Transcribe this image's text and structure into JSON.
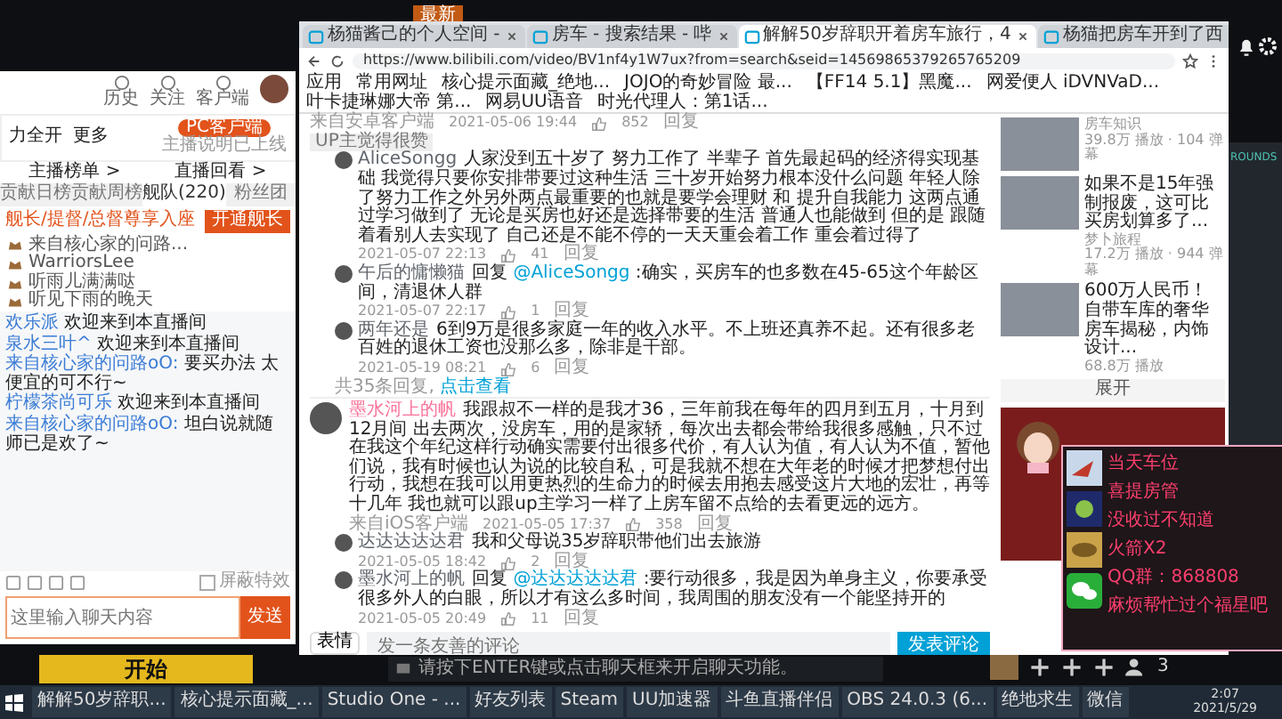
{
  "top_label": "最新",
  "browser": {
    "tabs": [
      {
        "title": "杨猫酱己的个人空间 -",
        "selected": false
      },
      {
        "title": "房车 - 搜索结果 - 哔",
        "selected": false
      },
      {
        "title": "解解50岁辞职开着房车旅行，4",
        "selected": true
      },
      {
        "title": "杨猫把房车开到了西",
        "selected": false
      }
    ],
    "url": "https://www.bilibili.com/video/BV1nf4y1W7ux?from=search&seid=14569865379265765209",
    "bookmarks": [
      "应用",
      "常用网址",
      "核心提示面藏_绝地...",
      "JOJO的奇妙冒险 最...",
      "【FF14 5.1】黑魔...",
      "网爱便人 iDVNVaD...",
      "叶卡捷琳娜大帝 第...",
      "网易UU语音",
      "时光代理人：第1话..."
    ],
    "comments": [
      {
        "source": "来自安卓客户端",
        "date": "2021-05-06 19:44",
        "likes": "852",
        "reply_label": "回复",
        "tag": "UP主觉得很赞",
        "replies": [
          {
            "user": "AliceSongg",
            "text": "人家没到五十岁了 努力工作了 半辈子 首先最起码的经济得实现基础 我觉得只要你安排带要过这种生活 三十岁开始努力根本没什么问题 年轻人除了努力工作之外另外两点最重要的也就是要学会理财 和 提升自我能力 这两点通过学习做到了 无论是买房也好还是选择带要的生活 普通人也能做到 但的是 跟随着看别人去实现了 自己还是不能不停的一天天重会着工作 重会着过得了",
            "date": "2021-05-07 22:13",
            "likes": "41",
            "reply_label": "回复"
          },
          {
            "user": "午后的慵懒猫",
            "prefix": "回复",
            "mention": "@AliceSongg",
            "text": " :确实，买房车的也多数在45-65这个年龄区间，清退休人群",
            "date": "2021-05-07 22:17",
            "likes": "1",
            "reply_label": "回复"
          },
          {
            "user": "两年还是",
            "text": "6到9万是很多家庭一年的收入水平。不上班还真养不起。还有很多老百姓的退休工资也没那么多，除非是干部。",
            "date": "2021-05-19 08:21",
            "likes": "6",
            "reply_label": "回复"
          }
        ],
        "more_text": "共35条回复,",
        "more_link": "点击查看"
      },
      {
        "user": "墨水河上的帆",
        "text": "我跟叔不一样的是我才36，三年前我在每年的四月到五月，十月到12月间 出去两次，没房车，用的是家轿，每次出去都会带给我很多感触，只不过在我这个年纪这样行动确实需要付出很多代价，有人认为值，有人认为不值，暂他们说，我有时候也认为说的比较自私，可是我就不想在大年老的时候才把梦想付出行动，我想在我可以用更热烈的生命力的时候去用抱去感受这片大地的宏壮，再等十几年 我也就可以跟up主学习一样了上房车留不点给的去看更远的远方。",
        "source": "来自iOS客户端",
        "date": "2021-05-05 17:37",
        "likes": "358",
        "reply_label": "回复",
        "replies": [
          {
            "user": "达达达达达君",
            "text": "我和父母说35岁辞职带他们出去旅游",
            "date": "2021-05-05 18:42",
            "likes": "2",
            "reply_label": "回复"
          },
          {
            "user": "墨水河上的帆",
            "prefix": "回复",
            "mention": "@达达达达达君",
            "text": " :要行动很多，我是因为单身主义，你要承受很多外人的白眼，所以才有这么多时间，我周围的朋友没有一个能坚持开的",
            "date": "2021-05-05 20:49",
            "likes": "11",
            "reply_label": "回复"
          }
        ]
      }
    ],
    "comment_box": {
      "placeholder": "发一条友善的评论",
      "submit": "发表评论",
      "emoji": "表情"
    },
    "related": [
      {
        "author": "房车知识",
        "stats": "39.8万 播放 · 104 弹幕"
      },
      {
        "title": "如果不是15年强制报废，这可比买房划算多了...",
        "author": "梦卜旅程",
        "stats": "17.2万 播放 · 944 弹幕"
      },
      {
        "title": "600万人民币！自带车库的奢华房车揭秘，内饰设计...",
        "stats": "68.8万 播放"
      }
    ],
    "expand": "展开"
  },
  "live": {
    "nav": [
      {
        "label": "历史"
      },
      {
        "label": "关注"
      },
      {
        "label": "客户端"
      }
    ],
    "actions": [
      "力全开",
      "更多"
    ],
    "pc_button": "PC客户端",
    "pc_note": "主播说明已上线",
    "links": [
      "主播榜单 >",
      "直播回看 >"
    ],
    "tabs": [
      {
        "label": "贡献日榜",
        "selected": false
      },
      {
        "label": "贡献周榜",
        "selected": false
      },
      {
        "label": "舰队(220)",
        "selected": true
      },
      {
        "label": "粉丝团",
        "selected": false
      }
    ],
    "fleet_note": "舰长/提督/总督尊享入座",
    "fleet_button": "开通舰长",
    "members": [
      "来自核心家的问路...",
      "WarriorsLee",
      "听雨儿满满哒",
      "听见下雨的晚天"
    ],
    "chat": [
      {
        "name": "欢乐派",
        "text": "欢迎来到本直播间"
      },
      {
        "name": "泉水三叶^",
        "text": "欢迎来到本直播间"
      },
      {
        "name": "来自核心家的问路oO:",
        "text": "要买办法 太便宜的可不行~"
      },
      {
        "name": "柠檬茶尚可乐",
        "text": "欢迎来到本直播间"
      },
      {
        "name": "来自核心家的问路oO:",
        "text": "坦白说就随师已是欢了~"
      }
    ],
    "block_label": "屏蔽特效",
    "block_checked": false,
    "input_placeholder": "这里输入聊天内容",
    "send": "发送"
  },
  "game": {
    "title": "ROUNDS"
  },
  "overlay": {
    "lines": [
      "当天车位",
      "喜提房管",
      "没收过不知道",
      "火箭X2",
      "QQ群：868808",
      "麻烦帮忙过个福星吧"
    ]
  },
  "start_button": "开始",
  "chat_hint": "请按下ENTER键或点击聊天框来开启聊天功能。",
  "party_count": "3",
  "taskbar": {
    "apps": [
      "解解50岁辞职...",
      "核心提示面藏_...",
      "Studio One - ...",
      "好友列表",
      "Steam",
      "UU加速器",
      "斗鱼直播伴侣",
      "OBS 24.0.3 (6...",
      "绝地求生",
      "微信"
    ],
    "time": "2:07",
    "date": "2021/5/29"
  }
}
